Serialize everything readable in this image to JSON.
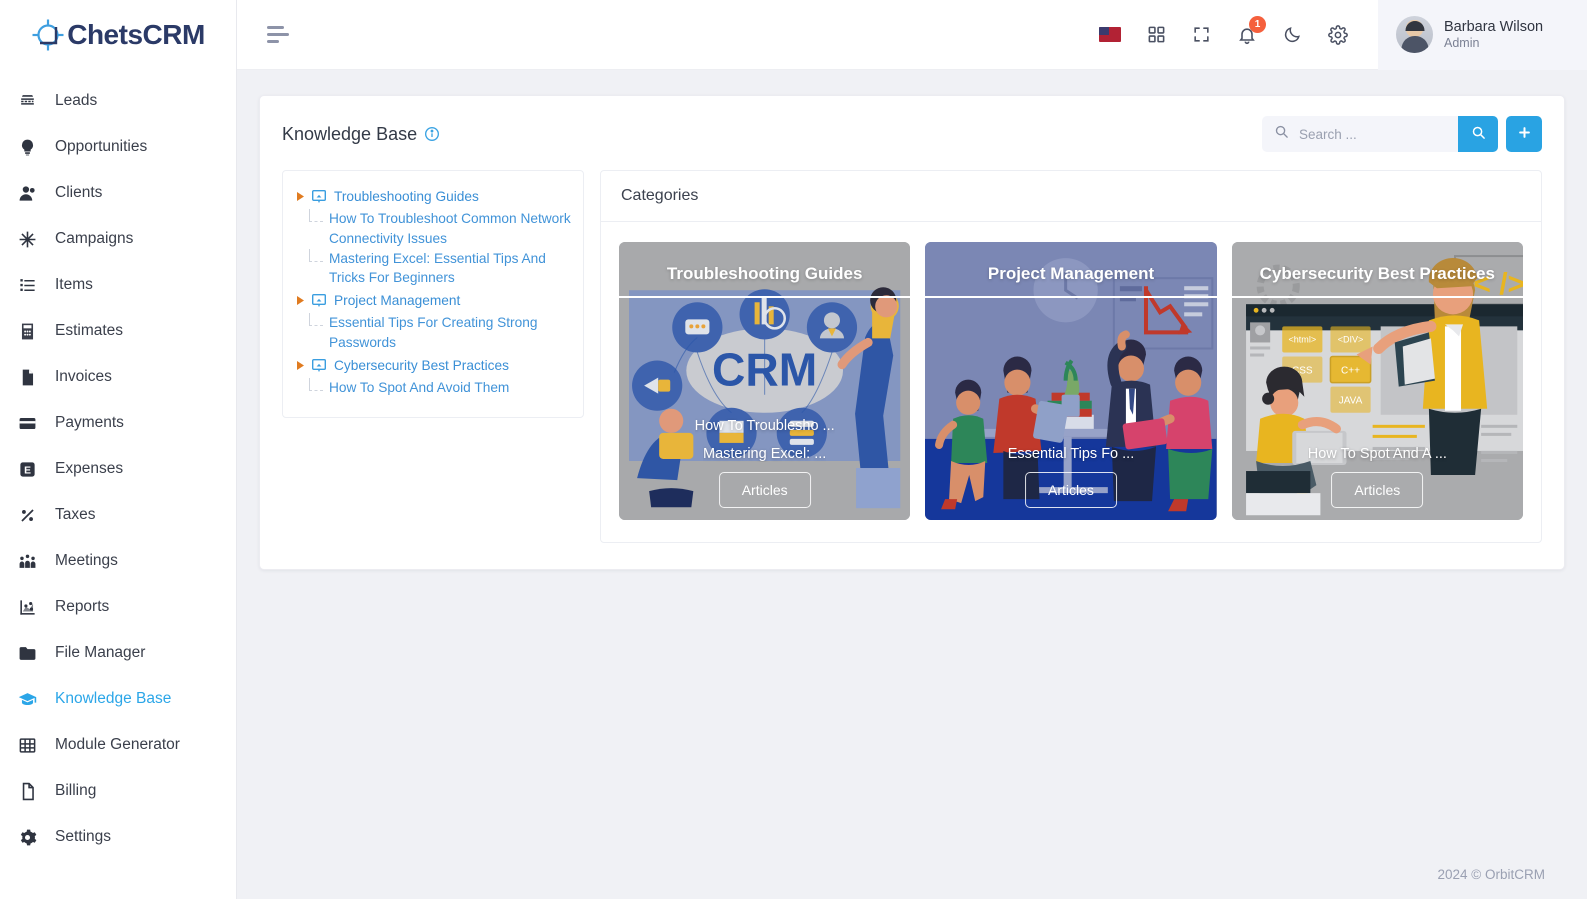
{
  "brand": {
    "name": "ChetsCRM",
    "logo_icon": "crosshair-logo-icon"
  },
  "sidebar": {
    "items": [
      {
        "label": "Leads",
        "icon": "leads-icon",
        "active": false
      },
      {
        "label": "Opportunities",
        "icon": "opportunities-icon",
        "active": false
      },
      {
        "label": "Clients",
        "icon": "clients-icon",
        "active": false
      },
      {
        "label": "Campaigns",
        "icon": "campaigns-icon",
        "active": false
      },
      {
        "label": "Items",
        "icon": "items-icon",
        "active": false
      },
      {
        "label": "Estimates",
        "icon": "estimates-icon",
        "active": false
      },
      {
        "label": "Invoices",
        "icon": "invoices-icon",
        "active": false
      },
      {
        "label": "Payments",
        "icon": "payments-icon",
        "active": false
      },
      {
        "label": "Expenses",
        "icon": "expenses-icon",
        "active": false
      },
      {
        "label": "Taxes",
        "icon": "taxes-icon",
        "active": false
      },
      {
        "label": "Meetings",
        "icon": "meetings-icon",
        "active": false
      },
      {
        "label": "Reports",
        "icon": "reports-icon",
        "active": false
      },
      {
        "label": "File Manager",
        "icon": "file-manager-icon",
        "active": false
      },
      {
        "label": "Knowledge Base",
        "icon": "graduation-cap-icon",
        "active": true
      },
      {
        "label": "Module Generator",
        "icon": "module-generator-icon",
        "active": false
      },
      {
        "label": "Billing",
        "icon": "billing-icon",
        "active": false
      },
      {
        "label": "Settings",
        "icon": "gear-icon",
        "active": false
      }
    ]
  },
  "topbar": {
    "menu_icon": "hamburger-icon",
    "icons": [
      {
        "name": "language-flag-us-icon"
      },
      {
        "name": "apps-grid-icon"
      },
      {
        "name": "fullscreen-icon"
      },
      {
        "name": "notifications-bell-icon",
        "badge": "1"
      },
      {
        "name": "dark-mode-moon-icon"
      },
      {
        "name": "settings-gear-icon"
      }
    ],
    "user": {
      "name": "Barbara Wilson",
      "role": "Admin"
    }
  },
  "page": {
    "title": "Knowledge Base",
    "info_icon": "info-circle-icon",
    "search": {
      "placeholder": "Search ...",
      "value": "",
      "icon": "search-icon"
    },
    "search_button_icon": "search-icon",
    "add_button_icon": "plus-icon"
  },
  "tree": {
    "nodes": [
      {
        "label": "Troubleshooting Guides",
        "icon": "window-icon",
        "children": [
          {
            "label": "How To Troubleshoot Common Network Connectivity Issues"
          },
          {
            "label": "Mastering Excel: Essential Tips And Tricks For Beginners"
          }
        ]
      },
      {
        "label": "Project Management",
        "icon": "window-icon",
        "children": [
          {
            "label": "Essential Tips For Creating Strong Passwords"
          }
        ]
      },
      {
        "label": "Cybersecurity Best Practices",
        "icon": "window-icon",
        "children": [
          {
            "label": "How To Spot And Avoid Them"
          }
        ]
      }
    ]
  },
  "categories": {
    "heading": "Categories",
    "cards": [
      {
        "title": "Troubleshooting Guides",
        "links": [
          "How To Troublesho ...",
          "Mastering Excel: ..."
        ],
        "button": "Articles",
        "bg_color": "#a8a9ab",
        "accent": "#3a64a8"
      },
      {
        "title": "Project Management",
        "links": [
          "Essential Tips Fo ..."
        ],
        "button": "Articles",
        "bg_color": "#7b87b4",
        "accent": "#1f3f92"
      },
      {
        "title": "Cybersecurity Best Practices",
        "links": [
          "How To Spot And A ..."
        ],
        "button": "Articles",
        "bg_color": "#aaabad",
        "accent": "#e8b520"
      }
    ]
  },
  "footer": {
    "text": "2024 © OrbitCRM"
  },
  "colors": {
    "accent_blue": "#29a3e3",
    "link_blue": "#3a8fd6",
    "badge_red": "#f5603d",
    "brand_navy": "#2b3a67",
    "page_bg": "#f0f1f5"
  }
}
